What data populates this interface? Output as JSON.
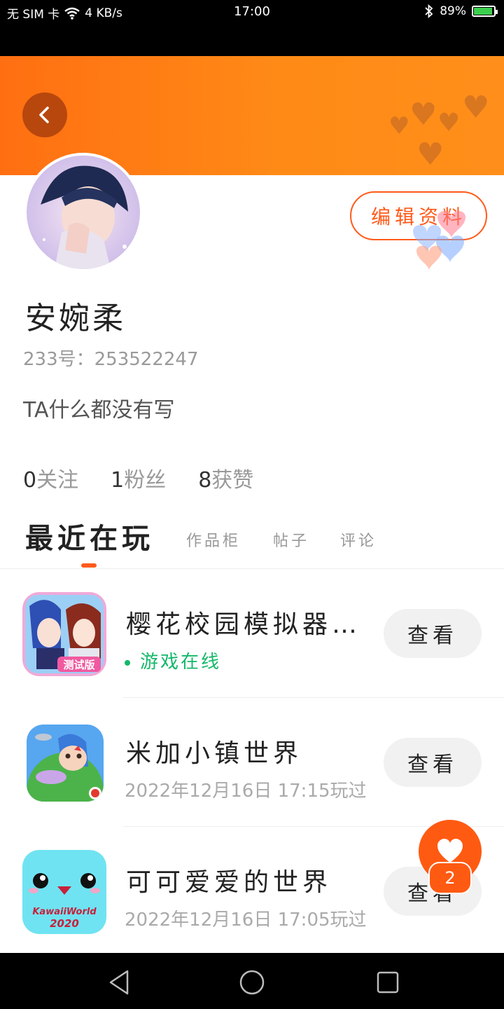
{
  "status_bar": {
    "sim": "无 SIM 卡",
    "speed": "4 KB/s",
    "time": "17:00",
    "battery": "89%"
  },
  "profile": {
    "name": "安婉柔",
    "uid": "233号：253522247",
    "bio": "TA什么都没有写",
    "edit_label": "编辑资料"
  },
  "stats": [
    {
      "num": "0",
      "label": "关注"
    },
    {
      "num": "1",
      "label": "粉丝"
    },
    {
      "num": "8",
      "label": "获赞"
    }
  ],
  "tabs": [
    {
      "label": "最近在玩",
      "active": true
    },
    {
      "label": "作品柜",
      "active": false
    },
    {
      "label": "帖子",
      "active": false
    },
    {
      "label": "评论",
      "active": false
    }
  ],
  "games": [
    {
      "title": "樱花校园模拟器…",
      "sub": "游戏在线",
      "online": true,
      "view_label": "查看",
      "icon_badge": "测试版"
    },
    {
      "title": "米加小镇世界",
      "sub": "2022年12月16日 17:15玩过",
      "online": false,
      "view_label": "查看"
    },
    {
      "title": "可可爱爱的世界",
      "sub": "2022年12月16日 17:05玩过",
      "online": false,
      "view_label": "查看",
      "icon_text": [
        "KawaiiWorld",
        "2020"
      ]
    }
  ],
  "fab": {
    "badge": "2"
  },
  "colors": {
    "accent": "#ff5a1a",
    "banner": "#ff7a14",
    "online": "#14b86a"
  }
}
